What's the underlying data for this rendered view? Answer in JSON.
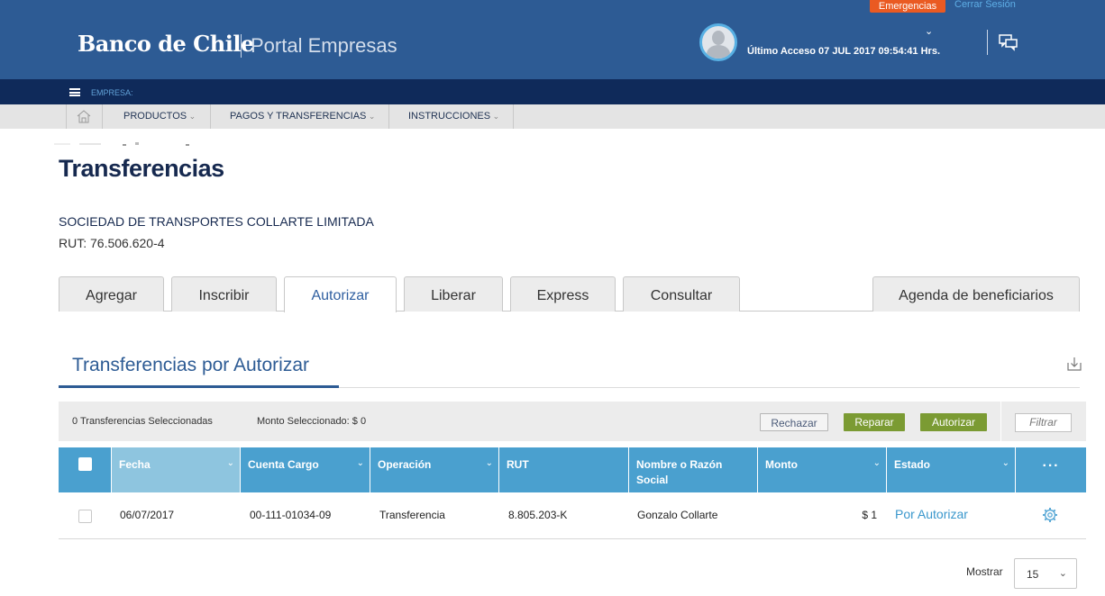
{
  "header": {
    "emergency_label": "Emergencias",
    "logout_label": "Cerrar Sesión",
    "logo_text": "Banco de Chile",
    "portal_label": "Portal Empresas",
    "last_access": "Último Acceso 07 JUL 2017 09:54:41 Hrs."
  },
  "empresa_bar": {
    "label": "EMPRESA:"
  },
  "nav": {
    "items": [
      {
        "label": "PRODUCTOS"
      },
      {
        "label": "PAGOS Y TRANSFERENCIAS"
      },
      {
        "label": "INSTRUCCIONES"
      }
    ]
  },
  "page": {
    "title": "Transferencias",
    "company_name": "SOCIEDAD DE TRANSPORTES COLLARTE LIMITADA",
    "company_rut": "RUT: 76.506.620-4"
  },
  "tabs": [
    {
      "label": "Agregar"
    },
    {
      "label": "Inscribir"
    },
    {
      "label": "Autorizar",
      "active": true
    },
    {
      "label": "Liberar"
    },
    {
      "label": "Express"
    },
    {
      "label": "Consultar"
    },
    {
      "label": "Agenda de beneficiarios"
    }
  ],
  "section": {
    "title": "Transferencias por Autorizar"
  },
  "actions": {
    "selected_count": "0 Transferencias Seleccionadas",
    "selected_amount": "Monto Seleccionado: $ 0",
    "reject_label": "Rechazar",
    "repair_label": "Reparar",
    "authorize_label": "Autorizar",
    "filter_placeholder": "Filtrar"
  },
  "table": {
    "columns": [
      "Fecha",
      "Cuenta Cargo",
      "Operación",
      "RUT",
      "Nombre o Razón Social",
      "Monto",
      "Estado"
    ],
    "more_label": "···",
    "rows": [
      {
        "fecha": "06/07/2017",
        "cuenta": "00-111-01034-09",
        "operacion": "Transferencia",
        "rut": "8.805.203-K",
        "nombre": "Gonzalo Collarte",
        "monto": "$ 1",
        "estado": "Por Autorizar"
      }
    ]
  },
  "pagination": {
    "show_label": "Mostrar",
    "page_size": "15"
  },
  "colors": {
    "header_bg": "#2d5b94",
    "empresa_bar_bg": "#0f2a5a",
    "table_header_bg": "#4aa0cf",
    "button_green": "#7b9b33",
    "emergency_orange": "#ea5a22"
  }
}
